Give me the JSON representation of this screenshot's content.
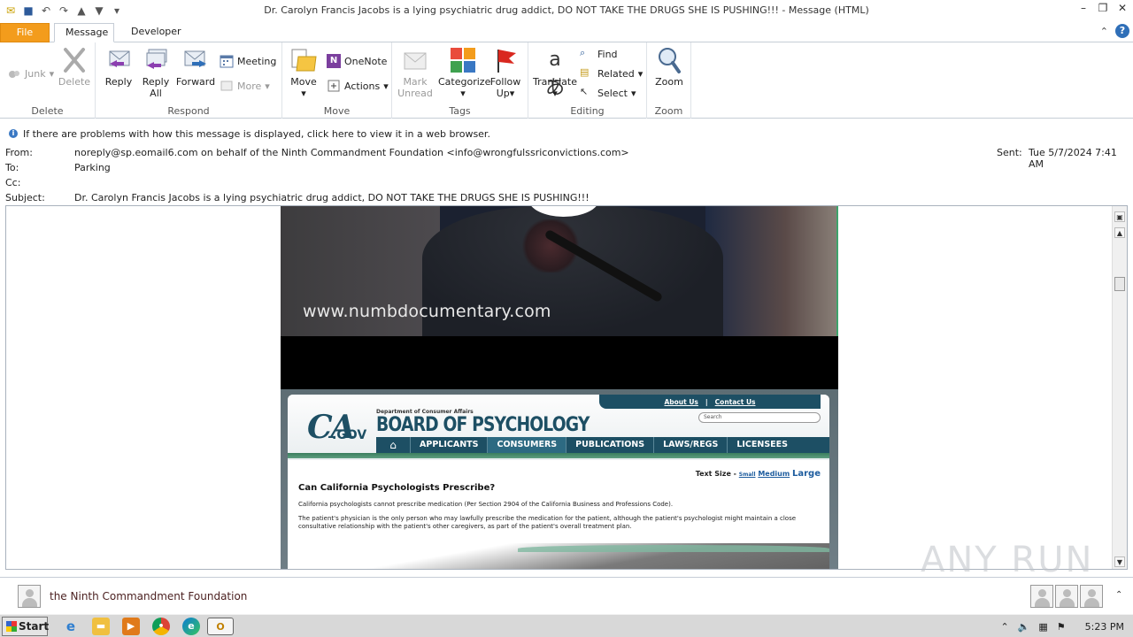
{
  "window": {
    "title": "Dr. Carolyn Francis Jacobs is a lying psychiatric drug addict, DO NOT TAKE THE DRUGS SHE IS PUSHING!!! - Message (HTML)"
  },
  "tabs": {
    "file": "File",
    "message": "Message",
    "developer": "Developer"
  },
  "ribbon": {
    "delete_group": {
      "label": "Delete",
      "junk": "Junk",
      "delete": "Delete"
    },
    "respond_group": {
      "label": "Respond",
      "reply": "Reply",
      "reply_all": "Reply All",
      "reply_all_line1": "Reply",
      "reply_all_line2": "All",
      "forward": "Forward",
      "meeting": "Meeting",
      "more": "More"
    },
    "move_group": {
      "label": "Move",
      "move": "Move",
      "onenote": "OneNote",
      "actions": "Actions"
    },
    "tags_group": {
      "label": "Tags",
      "mark_unread_1": "Mark",
      "mark_unread_2": "Unread",
      "categorize": "Categorize",
      "follow_up_1": "Follow",
      "follow_up_2": "Up"
    },
    "editing_group": {
      "label": "Editing",
      "translate": "Translate",
      "find": "Find",
      "related": "Related",
      "select": "Select"
    },
    "zoom_group": {
      "label": "Zoom",
      "zoom": "Zoom"
    }
  },
  "infobar": {
    "text": "If there are problems with how this message is displayed, click here to view it in a web browser."
  },
  "headers": {
    "from_label": "From:",
    "from_value": "noreply@sp.eomail6.com on behalf of the Ninth Commandment Foundation <info@wrongfulssriconvictions.com>",
    "to_label": "To:",
    "to_value": "Parking",
    "cc_label": "Cc:",
    "subject_label": "Subject:",
    "subject_value": "Dr. Carolyn Francis Jacobs is a lying psychiatric drug addict, DO NOT TAKE THE DRUGS SHE IS PUSHING!!!",
    "sent_label": "Sent:",
    "sent_value": "Tue 5/7/2024 7:41 AM"
  },
  "body": {
    "video_url": "www.numbdocumentary.com",
    "ca_page": {
      "about_us": "About Us",
      "contact_us": "Contact Us",
      "sep": "|",
      "logo": "CA",
      "logo_gov": ".GOV",
      "dept": "Department of Consumer Affairs",
      "board": "BOARD OF PSYCHOLOGY",
      "search_placeholder": "Search",
      "nav": [
        "APPLICANTS",
        "CONSUMERS",
        "PUBLICATIONS",
        "LAWS/REGS",
        "LICENSEES"
      ],
      "text_size_label": "Text Size -",
      "text_size_small": "Small",
      "text_size_medium": "Medium",
      "text_size_large": "Large",
      "question": "Can California Psychologists Prescribe?",
      "para1": "California psychologists cannot prescribe  medication (Per Section 2904 of the California Business and Professions Code).",
      "para2": "The patient's physician is the only person who may lawfully prescribe the medication for the patient, although the patient's psychologist might maintain a close consultative relationship with the patient's other caregivers, as part of the patient's overall treatment plan."
    }
  },
  "watermark": "ANY RUN",
  "people_pane": {
    "name": "the Ninth Commandment Foundation"
  },
  "taskbar": {
    "start": "Start",
    "clock": "5:23 PM"
  },
  "colors": {
    "file_tab": "#f39c1c",
    "ca_blue": "#1d4f64",
    "ca_green": "#3a7d5e"
  }
}
